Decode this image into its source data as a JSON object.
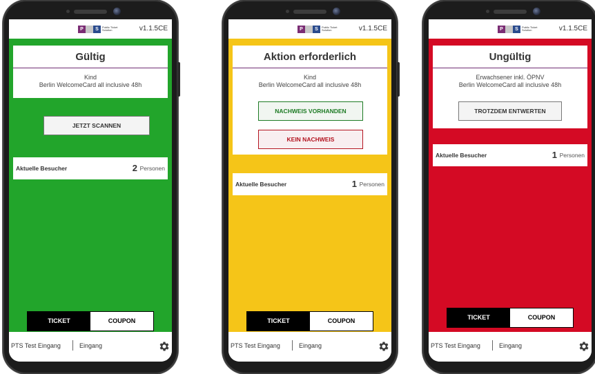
{
  "phones": [
    {
      "version": "v1.1.5CE",
      "status_title": "Gültig",
      "info_line1": "Kind",
      "info_line2": "Berlin WelcomeCard all inclusive 48h",
      "action_button": "JETZT SCANNEN",
      "visitors_label": "Aktuelle Besucher",
      "visitors_count": "2",
      "visitors_unit": "Personen",
      "toggle_ticket": "TICKET",
      "toggle_coupon": "COUPON",
      "location_name": "PTS Test Eingang",
      "location_type": "Eingang",
      "background_color": "#22a52b"
    },
    {
      "version": "v1.1.5CE",
      "status_title": "Aktion erforderlich",
      "info_line1": "Kind",
      "info_line2": "Berlin WelcomeCard all inclusive 48h",
      "button_proof_present": "NACHWEIS VORHANDEN",
      "button_no_proof": "KEIN NACHWEIS",
      "visitors_label": "Aktuelle Besucher",
      "visitors_count": "1",
      "visitors_unit": "Personen",
      "toggle_ticket": "TICKET",
      "toggle_coupon": "COUPON",
      "location_name": "PTS Test Eingang",
      "location_type": "Eingang",
      "background_color": "#f5c518"
    },
    {
      "version": "v1.1.5CE",
      "status_title": "Ungültig",
      "info_line1": "Erwachsener inkl. ÖPNV",
      "info_line2": "Berlin WelcomeCard all inclusive 48h",
      "action_button": "TROTZDEM ENTWERTEN",
      "visitors_label": "Aktuelle Besucher",
      "visitors_count": "1",
      "visitors_unit": "Personen",
      "toggle_ticket": "TICKET",
      "toggle_coupon": "COUPON",
      "location_name": "PTS Test Eingang",
      "location_type": "Eingang",
      "background_color": "#d40a24"
    }
  ],
  "logo": {
    "letter_p": "P",
    "letter_s": "S",
    "text_line1": "Public Ticket",
    "text_line2": "Solution"
  },
  "icons": {
    "settings": "gear-icon"
  }
}
